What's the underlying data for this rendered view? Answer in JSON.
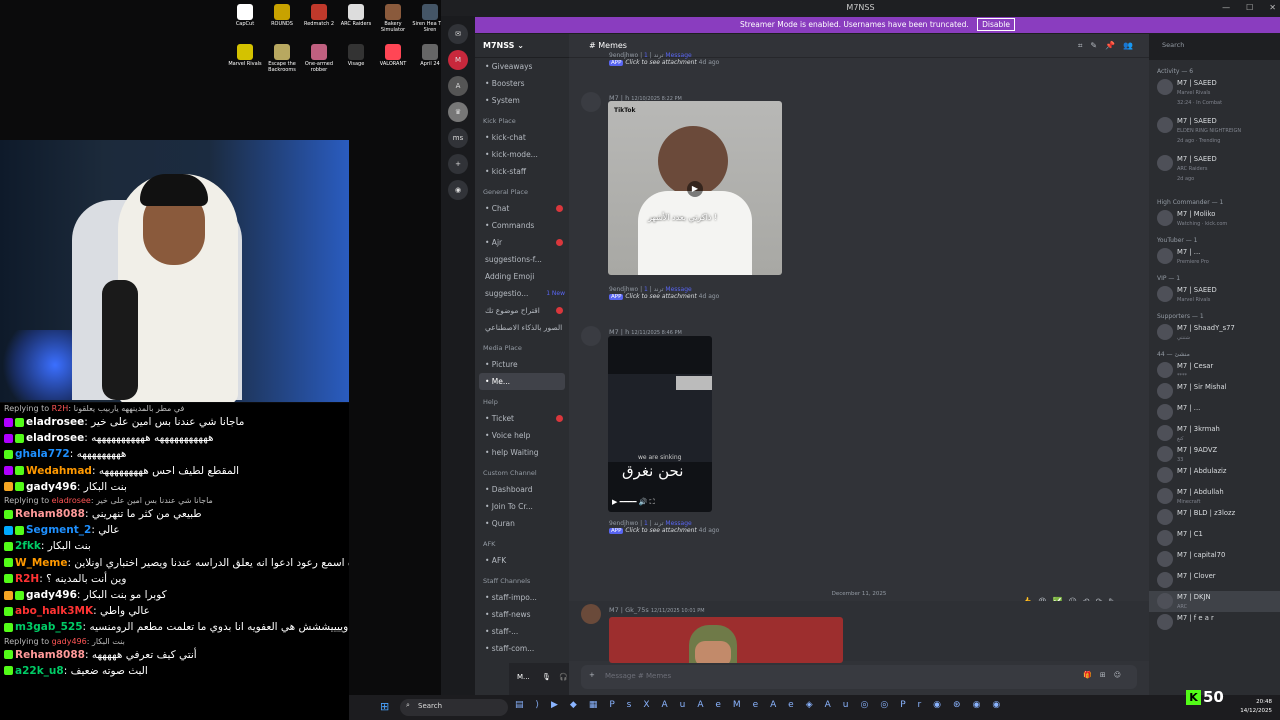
{
  "desktop": {
    "icons": [
      {
        "label": "CapCut",
        "color": "#ffffff"
      },
      {
        "label": "ROUNDS",
        "color": "#c8a200"
      },
      {
        "label": "Redmatch 2",
        "color": "#c0392b"
      },
      {
        "label": "ARC Raiders",
        "color": "#dddddd"
      },
      {
        "label": "Bakery Simulator",
        "color": "#8a5a3c"
      },
      {
        "label": "Siren Hea The Siren",
        "color": "#445566"
      },
      {
        "label": "Marvel Rivals",
        "color": "#d4c200"
      },
      {
        "label": "Escape the Backrooms",
        "color": "#b8a860"
      },
      {
        "label": "One-armed robber",
        "color": "#c06080"
      },
      {
        "label": "Visage",
        "color": "#333333"
      },
      {
        "label": "VALORANT",
        "color": "#ff4655"
      },
      {
        "label": "April 24",
        "color": "#666666"
      }
    ]
  },
  "chat": [
    {
      "type": "reply",
      "text": "Replying to",
      "user": "R2H",
      "msg": "في مطر بالمدينههه ياربيب يعلقونا"
    },
    {
      "user": "eladrosee",
      "color": "#ffffff",
      "badge": "#b000ff",
      "msg": "ماجانا شي عندنا بس امين على خير"
    },
    {
      "user": "eladrosee",
      "color": "#ffffff",
      "badge": "#b000ff",
      "msg": "هههههههههههه هههههههههههه"
    },
    {
      "user": "ghala772",
      "color": "#1e90ff",
      "badge": "",
      "msg": "هههههههههه"
    },
    {
      "user": "Wedahmad",
      "color": "#ff9900",
      "badge": "#b000ff",
      "msg": "المقطع لطيف احس هههههههههه"
    },
    {
      "user": "gady496",
      "color": "#ffffff",
      "badge": "#f5a623",
      "msg": "بنت البكار"
    },
    {
      "type": "reply",
      "text": "Replying to",
      "user": "eladrosee",
      "msg": "ماجانا شي عندنا بس امين على خير"
    },
    {
      "user": "Reham8088",
      "color": "#ff9999",
      "badge": "",
      "msg": "طبيعي من كثر ما تنهريني"
    },
    {
      "user": "Segment_2",
      "color": "#1e90ff",
      "badge": "#00aaff",
      "msg": "عالي"
    },
    {
      "user": "2fkk",
      "color": "#00cc66",
      "badge": "",
      "msg": "بنت البكار"
    },
    {
      "user": "W_Meme",
      "color": "#ff9900",
      "badge": "",
      "msg": "ياسلام قاعده اسمع رعود ادعوا انه يعلق الدراسه عندنا ويصير اختباري اونلاين"
    },
    {
      "user": "R2H",
      "color": "#ff3333",
      "badge": "",
      "msg": "وين أنت بالمدينه ؟"
    },
    {
      "user": "gady496",
      "color": "#ffffff",
      "badge": "#f5a623",
      "msg": "كوبرا مو بنت البكار"
    },
    {
      "user": "abo_halk3MK",
      "color": "#ff3333",
      "badge": "",
      "msg": "عالي واطي"
    },
    {
      "user": "m3gab_525",
      "color": "#00cc66",
      "badge": "",
      "msg": "يالربع وييييششش هي العفويه انا بدوي ما تعلمت مطعم الرومنسيه"
    },
    {
      "type": "reply",
      "text": "Replying to",
      "user": "gady496",
      "msg": "بنت البكار"
    },
    {
      "user": "Reham8088",
      "color": "#ff9999",
      "badge": "",
      "msg": "أنتي كيف تعرفي هههههه"
    },
    {
      "user": "a22k_u8",
      "color": "#00cc66",
      "badge": "",
      "msg": "البث صوته ضعيف"
    }
  ],
  "discord": {
    "window_title": "M7NSS",
    "banner": "Streamer Mode is enabled. Usernames have been truncated.",
    "banner_button": "Disable",
    "server_name": "M7NSS",
    "server_abbr": "ms",
    "channel_title": "Memes",
    "search_placeholder": "Search",
    "channels": [
      {
        "kind": "ch",
        "label": "• Giveaways"
      },
      {
        "kind": "ch",
        "label": "• Boosters"
      },
      {
        "kind": "ch",
        "label": "• System"
      },
      {
        "kind": "cat",
        "label": "Kick Place"
      },
      {
        "kind": "ch",
        "label": "• kick-chat"
      },
      {
        "kind": "ch",
        "label": "• kick-mode..."
      },
      {
        "kind": "ch",
        "label": "• kick-staff"
      },
      {
        "kind": "cat",
        "label": "General Place"
      },
      {
        "kind": "ch",
        "label": "• Chat",
        "notif": true
      },
      {
        "kind": "ch",
        "label": "• Commands"
      },
      {
        "kind": "ch",
        "label": "• Ajr",
        "notif": true
      },
      {
        "kind": "ch",
        "label": "suggestions-f..."
      },
      {
        "kind": "ch",
        "label": "Adding Emoji"
      },
      {
        "kind": "ch",
        "label": "suggestio...",
        "new": "1 New"
      },
      {
        "kind": "ch",
        "label": "اقتراح موضوع تك",
        "notif": true
      },
      {
        "kind": "ch",
        "label": "الصور بالذكاء الاصطناعي"
      },
      {
        "kind": "cat",
        "label": "Media Place"
      },
      {
        "kind": "ch",
        "label": "• Picture"
      },
      {
        "kind": "ch",
        "label": "• Me...",
        "active": true
      },
      {
        "kind": "cat",
        "label": "Help"
      },
      {
        "kind": "ch",
        "label": "• Ticket",
        "notif": true
      },
      {
        "kind": "ch",
        "label": "• Voice help"
      },
      {
        "kind": "ch",
        "label": "• help Waiting"
      },
      {
        "kind": "cat",
        "label": "Custom Channel"
      },
      {
        "kind": "ch",
        "label": "• Dashboard"
      },
      {
        "kind": "ch",
        "label": "• Join To Cr..."
      },
      {
        "kind": "ch",
        "label": "• Quran"
      },
      {
        "kind": "cat",
        "label": "AFK"
      },
      {
        "kind": "ch",
        "label": "• AFK"
      },
      {
        "kind": "cat",
        "label": "Staff Channels"
      },
      {
        "kind": "ch",
        "label": "• staff-impo..."
      },
      {
        "kind": "ch",
        "label": "• staff-news"
      },
      {
        "kind": "ch",
        "label": "• staff-..."
      },
      {
        "kind": "ch",
        "label": "• staff-com..."
      }
    ],
    "user_short": "M...",
    "messages": {
      "top_tag": {
        "user": "9endjhwo | ترند",
        "count": "1 Message",
        "app": "APP",
        "action": "Click to see attachment",
        "time": "4d ago"
      },
      "m1": {
        "user": "M7 | h",
        "time": "12/10/2025 8:22 PM",
        "tiktok": "TikTok",
        "caption": "ذاكرتي بعدد الأشهر !"
      },
      "tag1": {
        "user": "9endjhwo | ترند",
        "count": "1 Message",
        "app": "APP",
        "action": "Click to see attachment",
        "time": "4d ago"
      },
      "m2": {
        "user": "M7 | h",
        "time": "12/11/2025 8:46 PM",
        "sinking": "we are sinking",
        "caption": "نحن نغرق"
      },
      "tag2": {
        "user": "9endjhwo | ترند",
        "count": "1 Message",
        "app": "APP",
        "action": "Click to see attachment",
        "time": "4d ago"
      },
      "divider": "December 11, 2025",
      "m3": {
        "user": "M7 | Gk_75s",
        "time": "12/11/2025 10:01 PM"
      }
    },
    "composer_placeholder": "Message # Memes",
    "members": [
      {
        "cat": "Activity — 6"
      },
      {
        "name": "M7 | SAEED",
        "sub": "Marvel Rivals",
        "sub2": "32:24 · In Combat",
        "act": true
      },
      {
        "name": "M7 | SAEED",
        "sub": "ELDEN RING NIGHTREIGN",
        "sub2": "2d ago · Trending",
        "act": true
      },
      {
        "name": "M7 | SAEED",
        "sub": "ARC Raiders",
        "sub2": "2d ago",
        "act": true
      },
      {
        "cat": "High Commander — 1"
      },
      {
        "name": "M7 | Moliko",
        "sub": "Watching · kick.com"
      },
      {
        "cat": "YouTuber — 1"
      },
      {
        "name": "M7 | ...",
        "sub": "Premiere Pro"
      },
      {
        "cat": "VIP — 1"
      },
      {
        "name": "M7 | SAEED",
        "sub": "Marvel Rivals"
      },
      {
        "cat": "Supporters — 1"
      },
      {
        "name": "M7 | ShaadY_s77",
        "sub": "شتنتي"
      },
      {
        "cat": "44 — منشئ"
      },
      {
        "name": "M7 | Cesar",
        "sub": "****"
      },
      {
        "name": "M7 | Sir Mishal"
      },
      {
        "name": "M7 | ..."
      },
      {
        "name": "M7 | 3krmah",
        "sub": "كنغ"
      },
      {
        "name": "M7 | 9ADVZ",
        "sub": "33"
      },
      {
        "name": "M7 | Abdulaziz"
      },
      {
        "name": "M7 | Abdullah",
        "sub": "Minecraft"
      },
      {
        "name": "M7 | BLD | z3lozz"
      },
      {
        "name": "M7 | C1"
      },
      {
        "name": "M7 | capital70"
      },
      {
        "name": "M7 | Clover"
      },
      {
        "name": "M7 | DKJN",
        "sub": "ARC",
        "hl": true
      },
      {
        "name": "M7 | f e a r"
      }
    ]
  },
  "taskbar": {
    "search": "Search",
    "time": "20:48",
    "date": "14/12/2025"
  },
  "kick": {
    "count": "50"
  }
}
